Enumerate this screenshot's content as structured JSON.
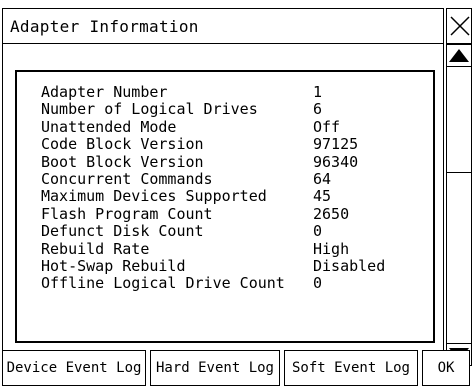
{
  "window": {
    "title": "Adapter Information"
  },
  "info": {
    "rows": [
      {
        "label": "Adapter Number",
        "value": "1"
      },
      {
        "label": "Number of Logical Drives",
        "value": "6"
      },
      {
        "label": "Unattended Mode",
        "value": "Off"
      },
      {
        "label": "Code Block Version",
        "value": "97125"
      },
      {
        "label": "Boot Block Version",
        "value": "96340"
      },
      {
        "label": "Concurrent Commands",
        "value": "64"
      },
      {
        "label": "Maximum Devices Supported",
        "value": "45"
      },
      {
        "label": "Flash Program Count",
        "value": "2650"
      },
      {
        "label": "Defunct Disk Count",
        "value": "0"
      },
      {
        "label": "Rebuild Rate",
        "value": "High"
      },
      {
        "label": "Hot-Swap Rebuild",
        "value": "Disabled"
      },
      {
        "label": "Offline Logical Drive Count",
        "value": "0"
      }
    ]
  },
  "buttons": {
    "device_event_log": "Device Event Log",
    "hard_event_log": "Hard Event Log",
    "soft_event_log": "Soft Event Log",
    "ok": "OK"
  },
  "icons": {
    "close": "close-icon",
    "scroll_up": "up-triangle-icon",
    "scroll_down": "down-triangle-icon"
  }
}
